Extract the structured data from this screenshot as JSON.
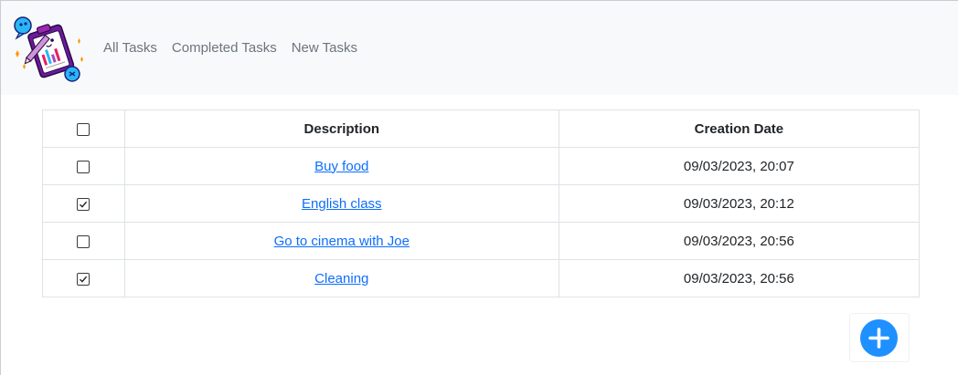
{
  "nav": {
    "items": [
      {
        "label": "All Tasks"
      },
      {
        "label": "Completed Tasks"
      },
      {
        "label": "New Tasks"
      }
    ],
    "logo_icon": "task-checklist-clipboard-icon"
  },
  "table": {
    "headers": {
      "description": "Description",
      "creation_date": "Creation Date"
    },
    "select_all_checked": false,
    "rows": [
      {
        "description": "Buy food",
        "creation_date": "09/03/2023, 20:07",
        "completed": false
      },
      {
        "description": "English class",
        "creation_date": "09/03/2023, 20:12",
        "completed": true
      },
      {
        "description": "Go to cinema with Joe",
        "creation_date": "09/03/2023, 20:56",
        "completed": false
      },
      {
        "description": "Cleaning",
        "creation_date": "09/03/2023, 20:56",
        "completed": true
      }
    ]
  },
  "add_button": {
    "icon": "plus-circle-icon",
    "color": "#1e90ff"
  },
  "colors": {
    "navbar_bg": "#f8f9fa",
    "nav_link": "#6c757d",
    "link": "#0d6efd"
  }
}
